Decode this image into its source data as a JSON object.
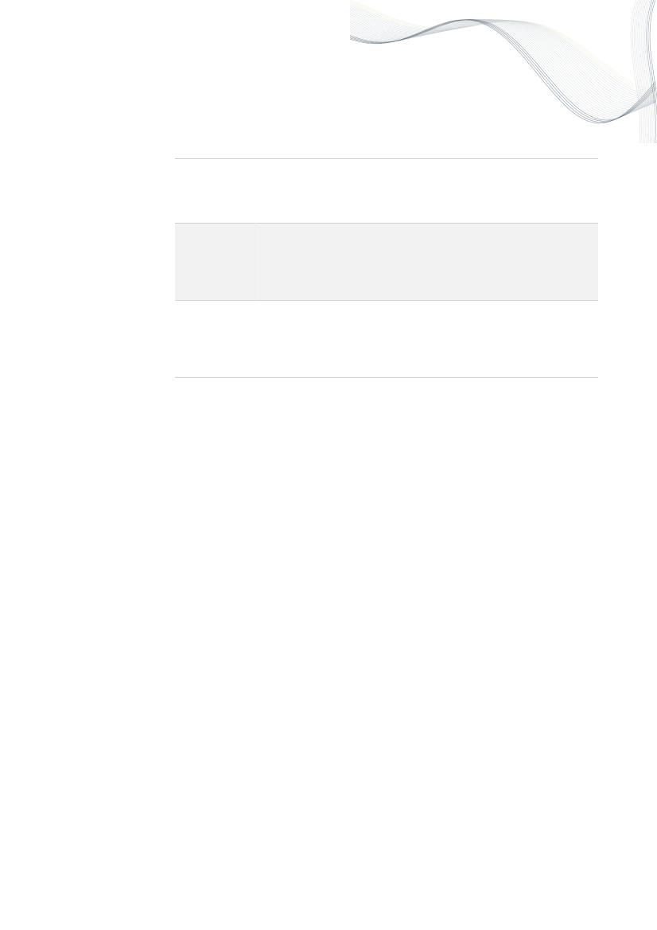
{
  "decoration": {
    "icon": "wave-lines-decoration",
    "colors": {
      "line_light": "#c9cfd4",
      "line_dark": "#5d6f82",
      "accent": "#e4e6c4"
    }
  },
  "table": {
    "rows": [
      {
        "label": "",
        "value": "",
        "shaded": false
      },
      {
        "label": "",
        "value": "",
        "shaded": true
      },
      {
        "label": "",
        "value": "",
        "shaded": false
      }
    ],
    "colors": {
      "rule": "#cfcfcf",
      "shade": "#f2f2f2"
    }
  }
}
